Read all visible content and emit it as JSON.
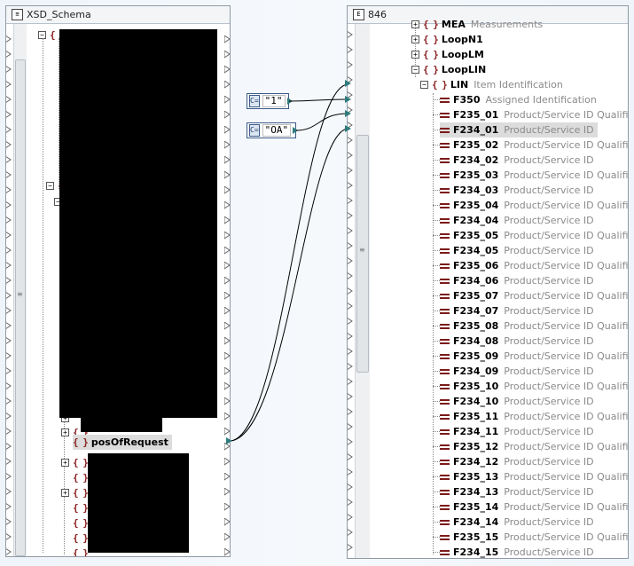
{
  "left_panel": {
    "title": "XSD_Schema",
    "icon": "schema-icon"
  },
  "right_panel": {
    "title": "846",
    "icon": "edi-icon"
  },
  "left_tree": {
    "root_label": "{ }",
    "pos_of_request": "posOfRequest"
  },
  "constants": [
    {
      "icon": "C=",
      "value": "\"1\""
    },
    {
      "icon": "C=",
      "value": "\"OA\""
    }
  ],
  "right_tree": {
    "top_partial": {
      "name": "MEA",
      "desc": "Measurements"
    },
    "loops": [
      "LoopN1",
      "LoopLM",
      "LoopLIN"
    ],
    "lin": {
      "name": "LIN",
      "desc": "Item Identification"
    },
    "fields": [
      {
        "name": "F350",
        "desc": "Assigned Identification"
      },
      {
        "name": "F235_01",
        "desc": "Product/Service ID Qualifier"
      },
      {
        "name": "F234_01",
        "desc": "Product/Service ID"
      },
      {
        "name": "F235_02",
        "desc": "Product/Service ID Qualifier"
      },
      {
        "name": "F234_02",
        "desc": "Product/Service ID"
      },
      {
        "name": "F235_03",
        "desc": "Product/Service ID Qualifier"
      },
      {
        "name": "F234_03",
        "desc": "Product/Service ID"
      },
      {
        "name": "F235_04",
        "desc": "Product/Service ID Qualifier"
      },
      {
        "name": "F234_04",
        "desc": "Product/Service ID"
      },
      {
        "name": "F235_05",
        "desc": "Product/Service ID Qualifier"
      },
      {
        "name": "F234_05",
        "desc": "Product/Service ID"
      },
      {
        "name": "F235_06",
        "desc": "Product/Service ID Qualifier"
      },
      {
        "name": "F234_06",
        "desc": "Product/Service ID"
      },
      {
        "name": "F235_07",
        "desc": "Product/Service ID Qualifier"
      },
      {
        "name": "F234_07",
        "desc": "Product/Service ID"
      },
      {
        "name": "F235_08",
        "desc": "Product/Service ID Qualifier"
      },
      {
        "name": "F234_08",
        "desc": "Product/Service ID"
      },
      {
        "name": "F235_09",
        "desc": "Product/Service ID Qualifier"
      },
      {
        "name": "F234_09",
        "desc": "Product/Service ID"
      },
      {
        "name": "F235_10",
        "desc": "Product/Service ID Qualifier"
      },
      {
        "name": "F234_10",
        "desc": "Product/Service ID"
      },
      {
        "name": "F235_11",
        "desc": "Product/Service ID Qualifier"
      },
      {
        "name": "F234_11",
        "desc": "Product/Service ID"
      },
      {
        "name": "F235_12",
        "desc": "Product/Service ID Qualifier"
      },
      {
        "name": "F234_12",
        "desc": "Product/Service ID"
      },
      {
        "name": "F235_13",
        "desc": "Product/Service ID Qualifier"
      },
      {
        "name": "F234_13",
        "desc": "Product/Service ID"
      },
      {
        "name": "F235_14",
        "desc": "Product/Service ID Qualifier"
      },
      {
        "name": "F234_14",
        "desc": "Product/Service ID"
      },
      {
        "name": "F235_15",
        "desc": "Product/Service ID Qualifier"
      },
      {
        "name": "F234_15",
        "desc": "Product/Service ID"
      }
    ]
  },
  "colors": {
    "element_icon": "#8a1f1f",
    "connector": "#2e7d7d",
    "line": "#000000",
    "highlight": "#dcdcdc"
  }
}
